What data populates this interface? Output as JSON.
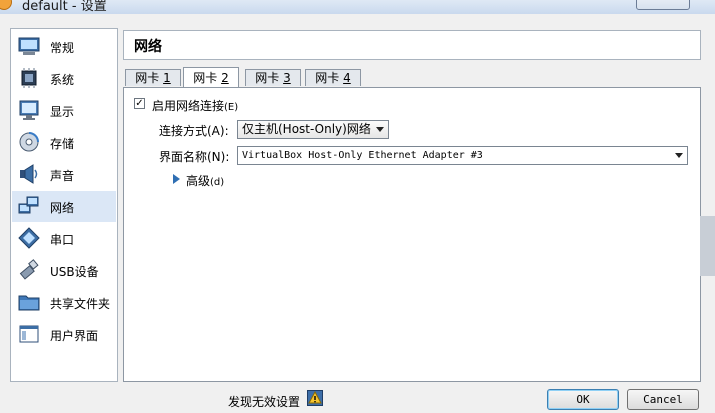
{
  "window": {
    "title": "default - 设置"
  },
  "sidebar": {
    "items": [
      {
        "label": "常规",
        "icon": "general-monitor-icon",
        "selected": false
      },
      {
        "label": "系统",
        "icon": "system-chip-icon",
        "selected": false
      },
      {
        "label": "显示",
        "icon": "display-monitor-icon",
        "selected": false
      },
      {
        "label": "存储",
        "icon": "storage-disk-icon",
        "selected": false
      },
      {
        "label": "声音",
        "icon": "speaker-icon",
        "selected": false
      },
      {
        "label": "网络",
        "icon": "network-icon",
        "selected": true
      },
      {
        "label": "串口",
        "icon": "serial-port-icon",
        "selected": false
      },
      {
        "label": "USB设备",
        "icon": "usb-icon",
        "selected": false
      },
      {
        "label": "共享文件夹",
        "icon": "shared-folder-icon",
        "selected": false
      },
      {
        "label": "用户界面",
        "icon": "user-interface-icon",
        "selected": false
      }
    ]
  },
  "page": {
    "title": "网络"
  },
  "tabs": [
    {
      "label": "网卡",
      "num": "1",
      "active": false
    },
    {
      "label": "网卡",
      "num": "2",
      "active": true
    },
    {
      "label": "网卡",
      "num": "3",
      "active": false
    },
    {
      "label": "网卡",
      "num": "4",
      "active": false
    }
  ],
  "adapter": {
    "enable_label": "启用网络连接",
    "enable_shortcut": "(E)",
    "enabled": true,
    "attached_label": "连接方式(A):",
    "attached_value": "仅主机(Host-Only)网络",
    "name_label": "界面名称(N):",
    "name_value": "VirtualBox Host-Only Ethernet Adapter #3",
    "advanced_label": "高级",
    "advanced_shortcut": "(d)"
  },
  "footer": {
    "warning_text": "发现无效设置",
    "ok_label": "OK",
    "cancel_label": "Cancel"
  },
  "colors": {
    "selected_bg": "#dbe7f6",
    "accent": "#2f6fb3"
  }
}
